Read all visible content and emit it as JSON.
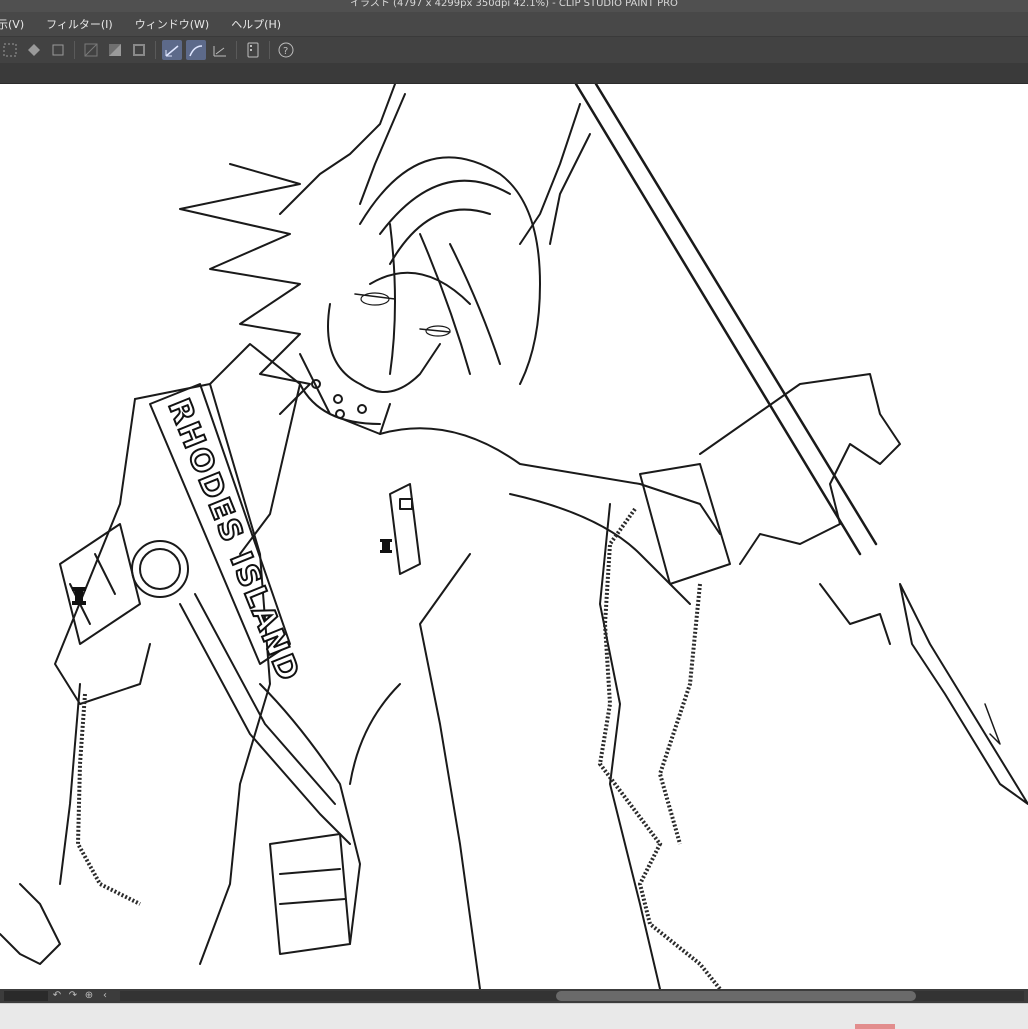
{
  "window": {
    "title": "イラスト (4797 x 4299px 350dpi 42.1%) - CLIP STUDIO PAINT PRO"
  },
  "menu": {
    "items": [
      {
        "label": "表示(V)"
      },
      {
        "label": "フィルター(I)"
      },
      {
        "label": "ウィンドウ(W)"
      },
      {
        "label": "ヘルプ(H)"
      }
    ]
  },
  "toolbar": {
    "icons": [
      "select-dotted-icon",
      "fill-icon",
      "crop-icon",
      "transparent-icon",
      "mask-icon",
      "frame-icon",
      "pen-stroke-icon",
      "pen-curve-icon",
      "ruler-icon",
      "device-icon",
      "help-icon"
    ]
  },
  "canvas": {
    "sash_text": "RHODES ISLAND"
  },
  "colors": {
    "chrome_dark": "#3b3b3b",
    "menubar": "#484848",
    "toolbar_active": "#5d6a8a",
    "canvas": "#ffffff",
    "taskbar": "#e9e9e9"
  }
}
